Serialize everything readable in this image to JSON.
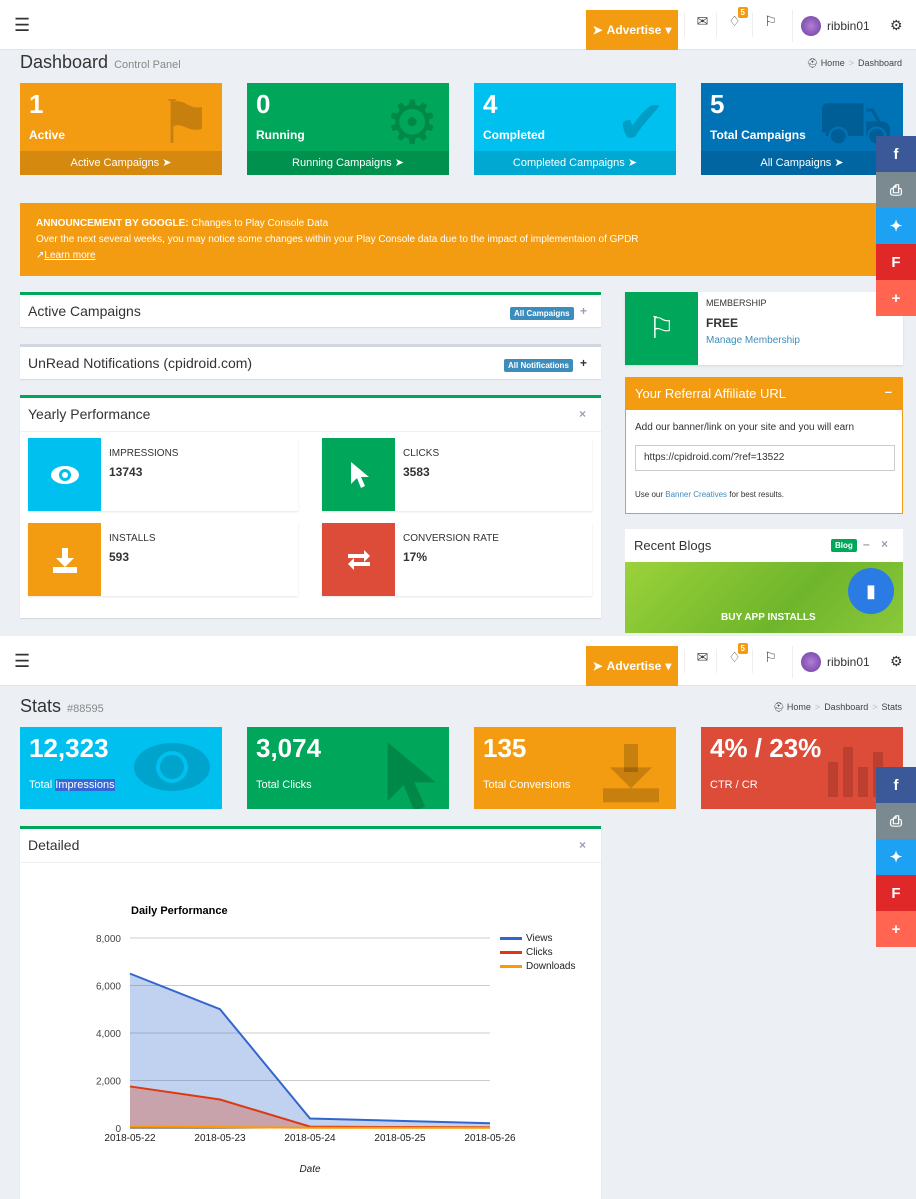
{
  "nav": {
    "advertise": "Advertise",
    "notif_count": "5",
    "username": "ribbin01"
  },
  "dashboard": {
    "title": "Dashboard",
    "subtitle": "Control Panel",
    "breadcrumb": [
      "Home",
      "Dashboard"
    ],
    "boxes": [
      {
        "value": "1",
        "label": "Active",
        "footer": "Active Campaigns"
      },
      {
        "value": "0",
        "label": "Running",
        "footer": "Running Campaigns"
      },
      {
        "value": "4",
        "label": "Completed",
        "footer": "Completed Campaigns"
      },
      {
        "value": "5",
        "label": "Total Campaigns",
        "footer": "All Campaigns"
      }
    ],
    "announcement": {
      "heading": "ANNOUNCEMENT BY GOOGLE:",
      "title": "Changes to Play Console Data",
      "body": "Over the next several weeks, you may notice some changes within your Play Console data due to the impact of implementaion of GPDR",
      "link": "Learn more"
    },
    "active_campaigns": {
      "title": "Active Campaigns",
      "button": "All Campaigns"
    },
    "notifications": {
      "title": "UnRead Notifications (cpidroid.com)",
      "button": "All Notifications"
    },
    "yearly": {
      "title": "Yearly Performance",
      "items": [
        {
          "label": "IMPRESSIONS",
          "value": "13743"
        },
        {
          "label": "CLICKS",
          "value": "3583"
        },
        {
          "label": "INSTALLS",
          "value": "593"
        },
        {
          "label": "CONVERSION RATE",
          "value": "17%"
        }
      ]
    },
    "membership": {
      "label": "MEMBERSHIP",
      "plan": "FREE",
      "link": "Manage Membership"
    },
    "referral": {
      "title": "Your Referral Affiliate URL",
      "text": "Add our banner/link on your site and you will earn",
      "url": "https://cpidroid.com/?ref=13522",
      "foot_pre": "Use our",
      "foot_link": "Banner Creatives",
      "foot_post": "for best results."
    },
    "blogs": {
      "title": "Recent Blogs",
      "tag": "Blog",
      "banner": "BUY APP INSTALLS"
    }
  },
  "stats": {
    "title": "Stats",
    "subtitle": "#88595",
    "breadcrumb": [
      "Home",
      "Dashboard",
      "Stats"
    ],
    "boxes": [
      {
        "value": "12,323",
        "label_a": "Total ",
        "label_b": "Impressions"
      },
      {
        "value": "3,074",
        "label": "Total Clicks"
      },
      {
        "value": "135",
        "label": "Total Conversions"
      },
      {
        "value": "4% / 23%",
        "label": "CTR / CR"
      }
    ],
    "detailed_title": "Detailed"
  },
  "chart_data": {
    "type": "area",
    "title": "Daily Performance",
    "xlabel": "Date",
    "ylabel": "",
    "x": [
      "2018-05-22",
      "2018-05-23",
      "2018-05-24",
      "2018-05-25",
      "2018-05-26"
    ],
    "ylim": [
      0,
      8000
    ],
    "yticks": [
      "0",
      "2,000",
      "4,000",
      "6,000",
      "8,000"
    ],
    "series": [
      {
        "name": "Views",
        "color": "#3366cc",
        "values": [
          6500,
          5000,
          400,
          300,
          200
        ]
      },
      {
        "name": "Clicks",
        "color": "#dc3912",
        "values": [
          1750,
          1200,
          60,
          40,
          30
        ]
      },
      {
        "name": "Downloads",
        "color": "#ff9900",
        "values": [
          60,
          40,
          10,
          10,
          10
        ]
      }
    ],
    "legend": "right",
    "grid": true
  }
}
